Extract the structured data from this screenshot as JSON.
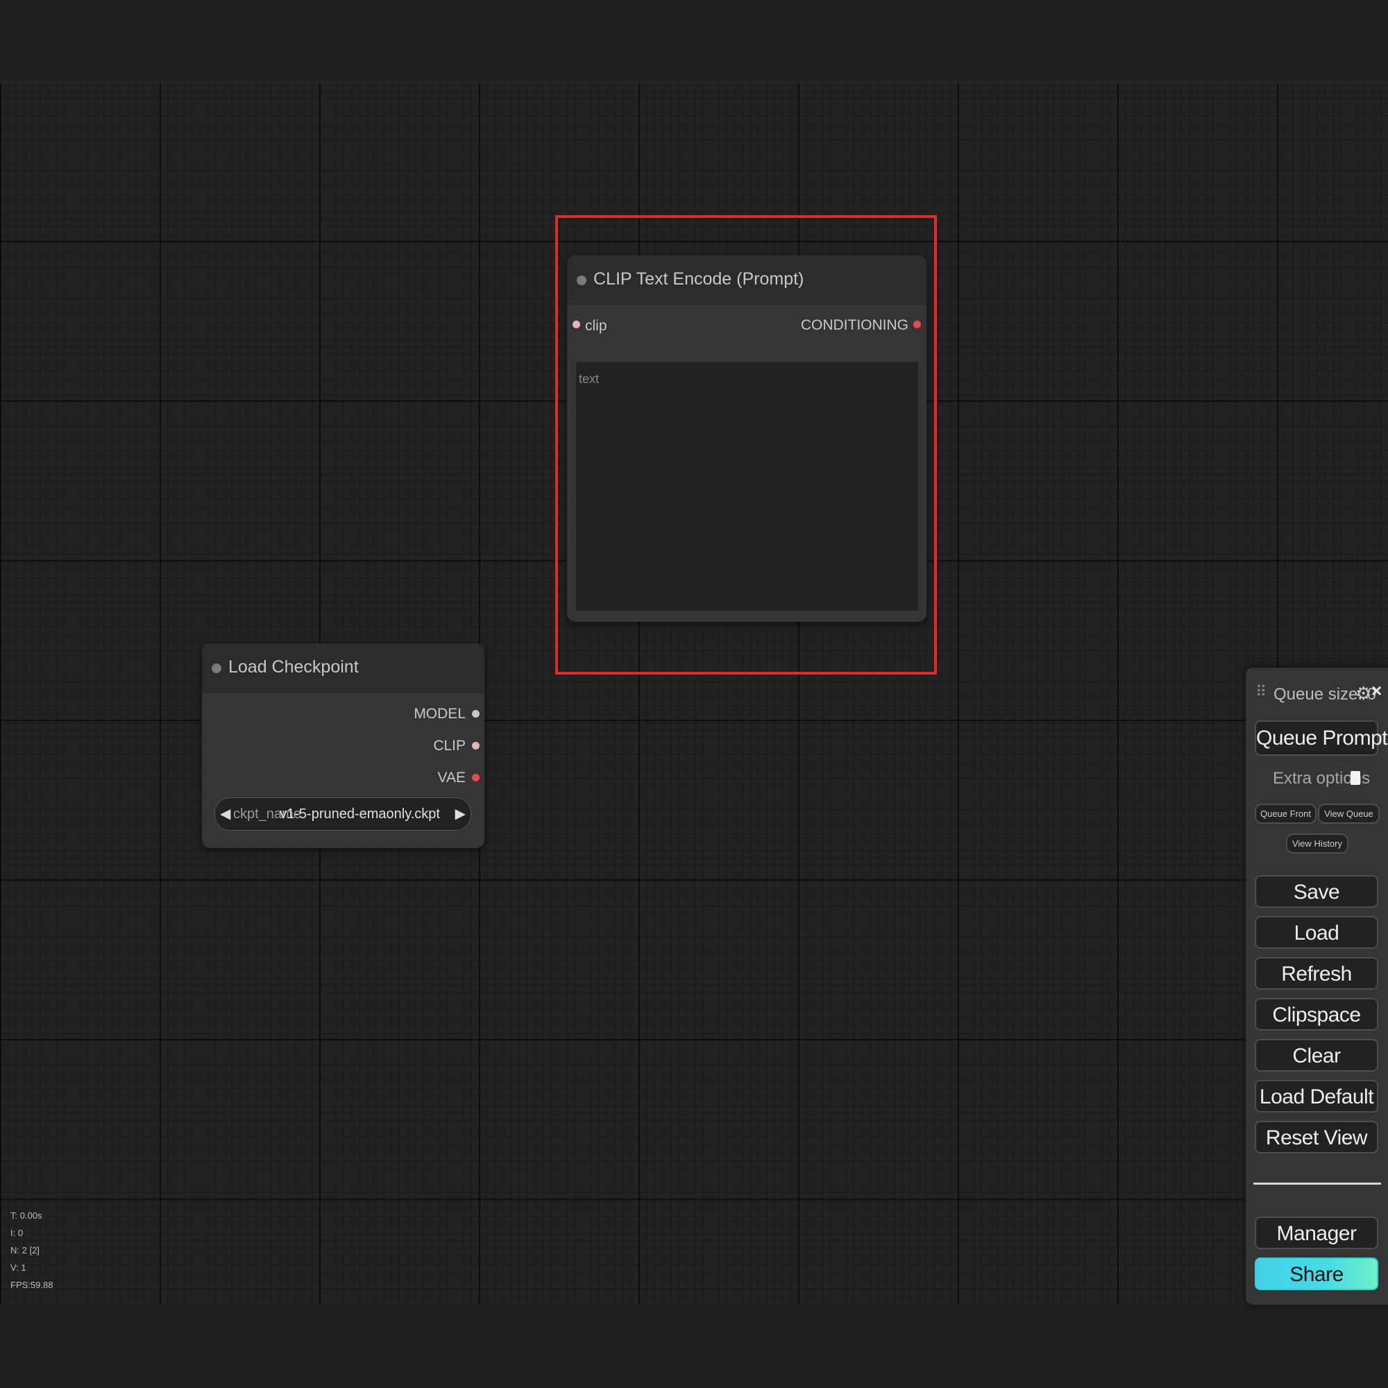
{
  "nodes": {
    "clip_text_encode": {
      "title": "CLIP Text Encode (Prompt)",
      "input": "clip",
      "output": "CONDITIONING",
      "text_placeholder": "text",
      "colors": {
        "input_dot": "#e6b6b6",
        "output_dot": "#e54a4a"
      }
    },
    "load_checkpoint": {
      "title": "Load Checkpoint",
      "outputs": [
        "MODEL",
        "CLIP",
        "VAE"
      ],
      "output_colors": [
        "#c8c8c8",
        "#e6b6b6",
        "#e54a4a"
      ],
      "widget": {
        "key": "ckpt_name",
        "value": "v1-5-pruned-emaonly.ckpt"
      }
    }
  },
  "stats": [
    "T: 0.00s",
    "I: 0",
    "N: 2 [2]",
    "V: 1",
    "FPS:59.88"
  ],
  "menu": {
    "queue_size": "Queue size: 0",
    "queue_prompt": "Queue Prompt",
    "extra_options": "Extra options",
    "queue_front": "Queue Front",
    "view_queue": "View Queue",
    "view_history": "View History",
    "buttons": [
      "Save",
      "Load",
      "Refresh",
      "Clipspace",
      "Clear",
      "Load Default",
      "Reset View"
    ],
    "manager": "Manager",
    "share": "Share",
    "colors": {
      "share_gradient_start": "#41d1e6",
      "share_gradient_end": "#6ef1c4"
    }
  },
  "highlight_color": "#e02b2b"
}
